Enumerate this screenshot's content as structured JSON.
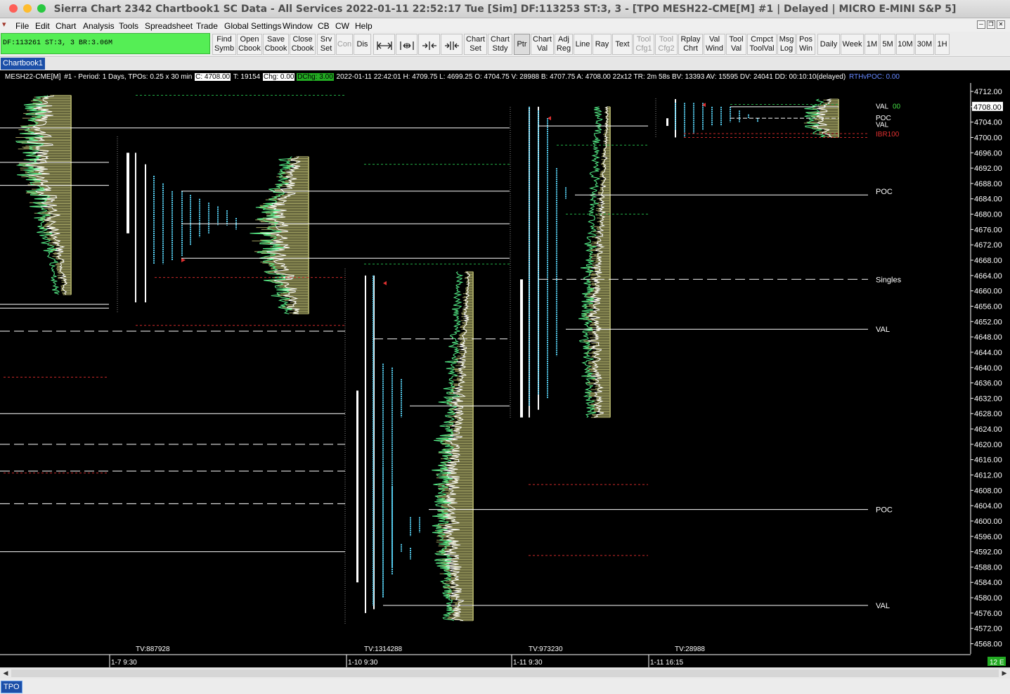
{
  "window": {
    "title": "Sierra Chart 2342 Chartbook1  SC Data - All Services 2022-01-11  22:52:17 Tue [Sim]  DF:113253  ST:3, 3 - [TPO MESH22-CME[M]  #1 | Delayed | MICRO E-MINI S&P 5]",
    "close_color": "#fe5f57",
    "minimize_color": "#febc2e",
    "zoom_color": "#28c840"
  },
  "menu": {
    "items": [
      "File",
      "Edit",
      "Chart",
      "Analysis",
      "Tools",
      "Spreadsheet",
      "Trade",
      "Global Settings",
      "Window",
      "CB",
      "CW",
      "Help"
    ],
    "window_controls": [
      "minimize-window-icon",
      "restore-window-icon",
      "close-window-icon"
    ]
  },
  "toolbar": {
    "status": "DF:113261  ST:3, 3  BR:3.06M",
    "status_color": "#55ee55",
    "buttons": [
      {
        "l1": "Find",
        "l2": "Symb"
      },
      {
        "l1": "Open",
        "l2": "Cbook"
      },
      {
        "l1": "Save",
        "l2": "Cbook"
      },
      {
        "l1": "Close",
        "l2": "Cbook"
      },
      {
        "l1": "Srv",
        "l2": "Set"
      },
      {
        "l1": "Con",
        "l2": ""
      },
      {
        "l1": "Dis",
        "l2": ""
      }
    ],
    "icon_buttons": [
      "expand-horizontal-icon",
      "fit-horizontal-icon",
      "compress-horizontal-icon",
      "compress-all-icon"
    ],
    "buttons2": [
      {
        "l1": "Chart",
        "l2": "Set"
      },
      {
        "l1": "Chart",
        "l2": "Stdy"
      },
      {
        "l1": "Ptr",
        "l2": ""
      },
      {
        "l1": "Chart",
        "l2": "Val"
      },
      {
        "l1": "Adj",
        "l2": "Reg"
      },
      {
        "l1": "Line",
        "l2": ""
      },
      {
        "l1": "Ray",
        "l2": ""
      },
      {
        "l1": "Text",
        "l2": ""
      },
      {
        "l1": "Tool",
        "l2": "Cfg1"
      },
      {
        "l1": "Tool",
        "l2": "Cfg2"
      },
      {
        "l1": "Rplay",
        "l2": "Chrt"
      },
      {
        "l1": "Val",
        "l2": "Wind"
      },
      {
        "l1": "Tool",
        "l2": "Val"
      },
      {
        "l1": "Cmpct",
        "l2": "ToolVal"
      },
      {
        "l1": "Msg",
        "l2": "Log"
      },
      {
        "l1": "Pos",
        "l2": "Win"
      },
      {
        "l1": "Daily",
        "l2": ""
      },
      {
        "l1": "Week",
        "l2": ""
      },
      {
        "l1": "1M",
        "l2": ""
      },
      {
        "l1": "5M",
        "l2": ""
      },
      {
        "l1": "10M",
        "l2": ""
      },
      {
        "l1": "30M",
        "l2": ""
      },
      {
        "l1": "1H",
        "l2": ""
      }
    ]
  },
  "tabs": {
    "chartbook": "Chartbook1",
    "bottom": "TPO"
  },
  "info": {
    "symbol": "MESH22-CME[M]",
    "period_text": "#1 - Period: 1 Days, TPOs: 0.25 x 30 min",
    "close": "C: 4708.00",
    "trades": "T: 19154",
    "change": "Chg: 0.00",
    "dchange": "DChg: 3.00",
    "details": "2022-01-11 22:42:01 H: 4709.75  L: 4699.25  O: 4704.75  V: 28988  B: 4707.75  A: 4708.00  22x12  TR: 2m 58s  BV: 13393  AV: 15595  DV: 24041  DD: 00:10:10(delayed)",
    "rthvpoc": "RTHvPOC: 0.00"
  },
  "price_axis": {
    "labels": [
      "4712.00",
      "4708.00",
      "4704.00",
      "4700.00",
      "4696.00",
      "4692.00",
      "4688.00",
      "4684.00",
      "4680.00",
      "4676.00",
      "4672.00",
      "4668.00",
      "4664.00",
      "4660.00",
      "4656.00",
      "4652.00",
      "4648.00",
      "4644.00",
      "4640.00",
      "4636.00",
      "4632.00",
      "4628.00",
      "4624.00",
      "4620.00",
      "4616.00",
      "4612.00",
      "4608.00",
      "4604.00",
      "4600.00",
      "4596.00",
      "4592.00",
      "4588.00",
      "4584.00",
      "4580.00",
      "4576.00",
      "4572.00",
      "4568.00"
    ],
    "current": "4708.00",
    "corner": "12 E"
  },
  "levels": {
    "right": [
      {
        "label": "POC",
        "price": 4686.0
      },
      {
        "label": "Singles",
        "price": 4663.0
      },
      {
        "label": "VAL",
        "price": 4650.0
      },
      {
        "label": "POC",
        "price": 4603.0
      },
      {
        "label": "VAL",
        "price": 4578.0
      }
    ],
    "current_day": [
      {
        "label": "VAL",
        "color": "#ffffff",
        "price": 4708.2
      },
      {
        "label": "00",
        "color": "#44dd44",
        "price": 4708.2
      },
      {
        "label": "POC",
        "color": "#ffffff",
        "price": 4705.2
      },
      {
        "label": "VAL",
        "color": "#ffffff",
        "price": 4703.5
      },
      {
        "label": "IBR100",
        "color": "#e03030",
        "price": 4701.0
      }
    ]
  },
  "volume_labels": [
    "TV:887928",
    "TV:1314288",
    "TV:973230",
    "TV:28988"
  ],
  "date_labels": [
    "1-7  9:30",
    "1-10  9:30",
    "1-11  9:30",
    "1-11  16:15"
  ],
  "colors": {
    "profile": "#a0a060",
    "vwap_line": "#55ee88",
    "tpo_letters": "#55ccee",
    "dashed_green": "#22aa44",
    "dashed_red": "#cc2a2a",
    "axis_bg": "#000000"
  }
}
